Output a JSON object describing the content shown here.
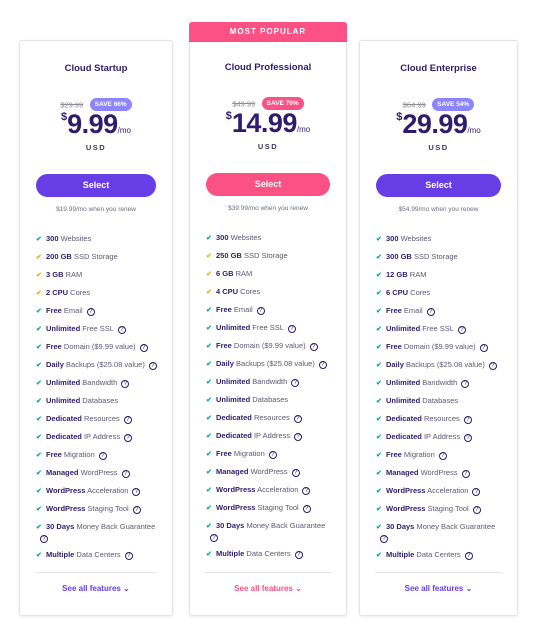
{
  "colors": {
    "purple": "#673de6",
    "pink": "#fc5185",
    "green": "#00b090",
    "orange": "#ffa800",
    "save_purple": "#8c85ff"
  },
  "banner": "MOST POPULAR",
  "plans": [
    {
      "name": "Cloud Startup",
      "old_price": "$29.99",
      "save": "SAVE 66%",
      "currency_symbol": "$",
      "price": "9.99",
      "per": "/mo",
      "currency": "USD",
      "select_label": "Select",
      "renew": "$19.99/mo when you renew",
      "see_all": "See all features",
      "features": [
        {
          "bold": "300",
          "text": " Websites",
          "check": "green",
          "info": false
        },
        {
          "bold": "200 GB",
          "text": " SSD Storage",
          "check": "orange",
          "info": false
        },
        {
          "bold": "3 GB",
          "text": " RAM",
          "check": "orange",
          "info": false
        },
        {
          "bold": "2 CPU",
          "text": " Cores",
          "check": "orange",
          "info": false
        },
        {
          "bold": "Free",
          "text": " Email",
          "check": "green",
          "info": true
        },
        {
          "bold": "Unlimited",
          "text": " Free SSL",
          "check": "green",
          "info": true
        },
        {
          "bold": "Free",
          "text": " Domain ($9.99 value)",
          "check": "green",
          "info": true
        },
        {
          "bold": "Daily",
          "text": " Backups ($25.08 value)",
          "check": "green",
          "info": true
        },
        {
          "bold": "Unlimited",
          "text": " Bandwidth",
          "check": "green",
          "info": true
        },
        {
          "bold": "Unlimited",
          "text": " Databases",
          "check": "green",
          "info": false
        },
        {
          "bold": "Dedicated",
          "text": " Resources",
          "check": "green",
          "info": true
        },
        {
          "bold": "Dedicated",
          "text": " IP Address",
          "check": "green",
          "info": true
        },
        {
          "bold": "Free",
          "text": " Migration",
          "check": "green",
          "info": true
        },
        {
          "bold": "Managed",
          "text": " WordPress",
          "check": "green",
          "info": true
        },
        {
          "bold": "WordPress",
          "text": " Acceleration",
          "check": "green",
          "info": true
        },
        {
          "bold": "WordPress",
          "text": " Staging Tool",
          "check": "green",
          "info": true
        },
        {
          "bold": "30 Days",
          "text": " Money Back Guarantee",
          "check": "green",
          "info": true
        },
        {
          "bold": "Multiple",
          "text": " Data Centers",
          "check": "green",
          "info": true
        }
      ]
    },
    {
      "name": "Cloud Professional",
      "old_price": "$49.99",
      "save": "SAVE 70%",
      "currency_symbol": "$",
      "price": "14.99",
      "per": "/mo",
      "currency": "USD",
      "select_label": "Select",
      "renew": "$39.99/mo when you renew",
      "see_all": "See all features",
      "features": [
        {
          "bold": "300",
          "text": " Websites",
          "check": "green",
          "info": false
        },
        {
          "bold": "250 GB",
          "text": " SSD Storage",
          "check": "orange",
          "info": false
        },
        {
          "bold": "6 GB",
          "text": " RAM",
          "check": "orange",
          "info": false
        },
        {
          "bold": "4 CPU",
          "text": " Cores",
          "check": "orange",
          "info": false
        },
        {
          "bold": "Free",
          "text": " Email",
          "check": "green",
          "info": true
        },
        {
          "bold": "Unlimited",
          "text": " Free SSL",
          "check": "green",
          "info": true
        },
        {
          "bold": "Free",
          "text": " Domain ($9.99 value)",
          "check": "green",
          "info": true
        },
        {
          "bold": "Daily",
          "text": " Backups ($25.08 value)",
          "check": "green",
          "info": true
        },
        {
          "bold": "Unlimited",
          "text": " Bandwidth",
          "check": "green",
          "info": true
        },
        {
          "bold": "Unlimited",
          "text": " Databases",
          "check": "green",
          "info": false
        },
        {
          "bold": "Dedicated",
          "text": " Resources",
          "check": "green",
          "info": true
        },
        {
          "bold": "Dedicated",
          "text": " IP Address",
          "check": "green",
          "info": true
        },
        {
          "bold": "Free",
          "text": " Migration",
          "check": "green",
          "info": true
        },
        {
          "bold": "Managed",
          "text": " WordPress",
          "check": "green",
          "info": true
        },
        {
          "bold": "WordPress",
          "text": " Acceleration",
          "check": "green",
          "info": true
        },
        {
          "bold": "WordPress",
          "text": " Staging Tool",
          "check": "green",
          "info": true
        },
        {
          "bold": "30 Days",
          "text": " Money Back Guarantee",
          "check": "green",
          "info": true
        },
        {
          "bold": "Multiple",
          "text": " Data Centers",
          "check": "green",
          "info": true
        }
      ]
    },
    {
      "name": "Cloud Enterprise",
      "old_price": "$64.99",
      "save": "SAVE 54%",
      "currency_symbol": "$",
      "price": "29.99",
      "per": "/mo",
      "currency": "USD",
      "select_label": "Select",
      "renew": "$54.99/mo when you renew",
      "see_all": "See all features",
      "features": [
        {
          "bold": "300",
          "text": " Websites",
          "check": "green",
          "info": false
        },
        {
          "bold": "300 GB",
          "text": " SSD Storage",
          "check": "green",
          "info": false
        },
        {
          "bold": "12 GB",
          "text": " RAM",
          "check": "green",
          "info": false
        },
        {
          "bold": "6 CPU",
          "text": " Cores",
          "check": "green",
          "info": false
        },
        {
          "bold": "Free",
          "text": " Email",
          "check": "green",
          "info": true
        },
        {
          "bold": "Unlimited",
          "text": " Free SSL",
          "check": "green",
          "info": true
        },
        {
          "bold": "Free",
          "text": " Domain ($9.99 value)",
          "check": "green",
          "info": true
        },
        {
          "bold": "Daily",
          "text": " Backups ($25.08 value)",
          "check": "green",
          "info": true
        },
        {
          "bold": "Unlimited",
          "text": " Bandwidth",
          "check": "green",
          "info": true
        },
        {
          "bold": "Unlimited",
          "text": " Databases",
          "check": "green",
          "info": false
        },
        {
          "bold": "Dedicated",
          "text": " Resources",
          "check": "green",
          "info": true
        },
        {
          "bold": "Dedicated",
          "text": " IP Address",
          "check": "green",
          "info": true
        },
        {
          "bold": "Free",
          "text": " Migration",
          "check": "green",
          "info": true
        },
        {
          "bold": "Managed",
          "text": " WordPress",
          "check": "green",
          "info": true
        },
        {
          "bold": "WordPress",
          "text": " Acceleration",
          "check": "green",
          "info": true
        },
        {
          "bold": "WordPress",
          "text": " Staging Tool",
          "check": "green",
          "info": true
        },
        {
          "bold": "30 Days",
          "text": " Money Back Guarantee",
          "check": "green",
          "info": true
        },
        {
          "bold": "Multiple",
          "text": " Data Centers",
          "check": "green",
          "info": true
        }
      ]
    }
  ]
}
